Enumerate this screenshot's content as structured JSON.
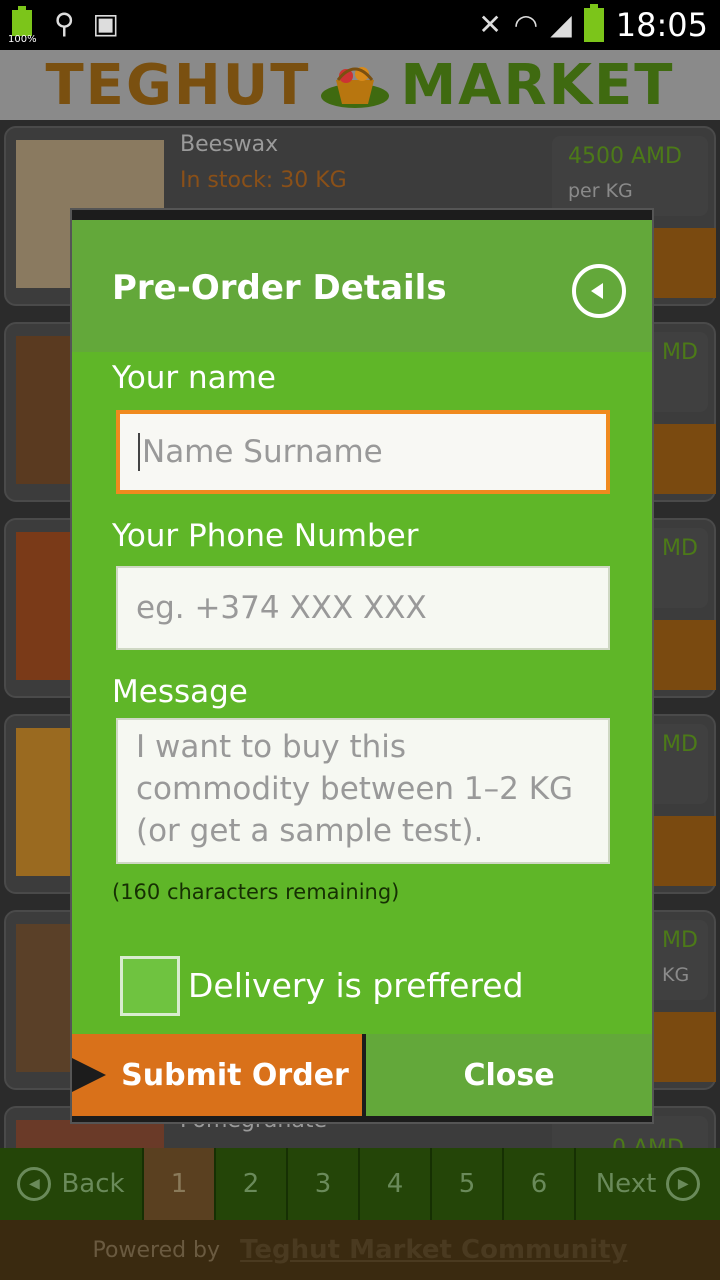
{
  "status_bar": {
    "battery_left_label": "100%",
    "time": "18:05"
  },
  "header": {
    "logo_left": "TEGHUT",
    "logo_right": "MARKET"
  },
  "list": {
    "items": [
      {
        "title": "Beeswax",
        "stock": "In stock: 30 KG",
        "price": "4500 AMD",
        "unit": "per KG"
      },
      {
        "title": "",
        "stock": "",
        "price": "MD",
        "unit": ""
      },
      {
        "title": "",
        "stock": "",
        "price": "MD",
        "unit": ""
      },
      {
        "title": "",
        "stock": "",
        "price": "MD",
        "unit": ""
      },
      {
        "title": "",
        "stock": "",
        "price": "MD",
        "unit": "KG"
      },
      {
        "title": "Pomegranate",
        "stock": "",
        "price": "0 AMD",
        "unit": ""
      }
    ]
  },
  "pager": {
    "back": "Back",
    "pages": [
      "1",
      "2",
      "3",
      "4",
      "5",
      "6"
    ],
    "next": "Next"
  },
  "footer": {
    "powered_by": "Powered by",
    "community": "Teghut Market Community"
  },
  "dialog": {
    "title": "Pre-Order Details",
    "name_label": "Your name",
    "name_placeholder": "Name Surname",
    "phone_label": "Your Phone Number",
    "phone_placeholder": "eg. +374 XXX XXX",
    "message_label": "Message",
    "message_placeholder": "I want to buy this commodity between 1–2 KG (or get a sample test).",
    "chars_remaining": "(160 characters remaining)",
    "delivery_label": "Delivery is preffered",
    "submit": "Submit Order",
    "close": "Close"
  },
  "colors": {
    "dialog_green": "#5fb628",
    "header_green": "#63a83a",
    "accent_orange": "#d9711a"
  }
}
